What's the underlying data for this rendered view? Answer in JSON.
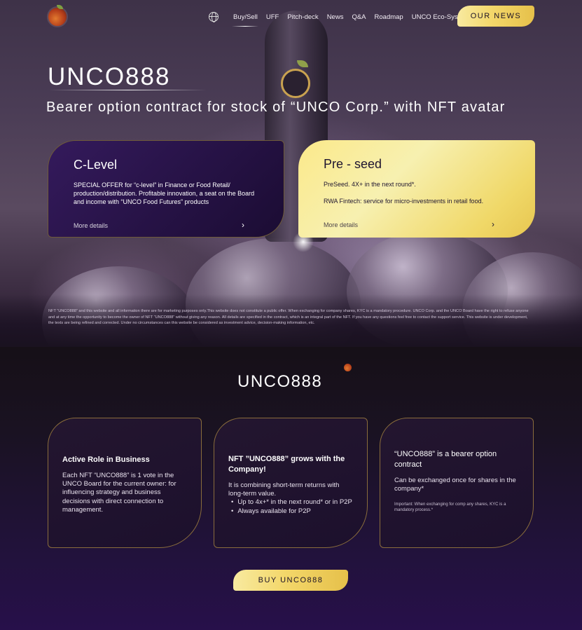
{
  "header": {
    "nav": [
      "Buy/Sell",
      "UFF",
      "Pitch-deck",
      "News",
      "Q&A",
      "Roadmap",
      "UNCO Eco-System"
    ],
    "news_button": "OUR NEWS"
  },
  "hero": {
    "title": "UNCO888",
    "subtitle": "Bearer option contract for stock of “UNCO Corp.” with NFT avatar"
  },
  "cards": [
    {
      "title": "C-Level",
      "paragraphs": [
        "SPECIAL OFFER for “c-level” in Finance or Food Retail/ production/distribution. Profitable innovation, a seat on the Board and income with “UNCO Food Futures” products"
      ],
      "more": "More details",
      "chevron": "›"
    },
    {
      "title": "Pre - seed",
      "paragraphs": [
        "PreSeed. 4X+ in the next round*.",
        "RWA Fintech: service for micro-investments in retail food."
      ],
      "more": "More details",
      "chevron": "›"
    }
  ],
  "disclaimer": "NFT “UNCO888” and this website and all information there are for marketing purposes only.This website does not constitute a public offer. When exchanging for company shares, KYC is a mandatory procedure. UNCO Corp. and the UNCO Board have the right to refuse anyone and at any time the opportunity to become the owner of NFT “UNCO888” without giving any reason. All details are specified in the contract, which is an integral part of the NFT. If you have any questions feel free to contact the support service. This website is under development, the texts are being refined and corrected. Under no circumstances can this website be considered as investment advice, decision-making information, etc.",
  "lower": {
    "logo": "UNCO888",
    "features": [
      {
        "title": "Active Role in Business",
        "text": "Each NFT “UNCO888” is 1 vote in the UNCO Board for the current owner: for influencing strategy and business decisions with direct connection to management."
      },
      {
        "title": "NFT ”UNCO888” grows with the  Company!",
        "text": "It is combining short-term returns with long-term value.",
        "bullets": [
          "Up to 4x+* in the next round* or in P2P",
          "Always available for P2P"
        ]
      },
      {
        "title": "“UNCO888” is a bearer option contract",
        "text": "Can be exchanged once for shares in the company*",
        "note": "Important: When exchanging for comp any shares, KYC is a mandatory process.*"
      }
    ],
    "buy_button": "BUY UNCO888"
  },
  "colors": {
    "gold": "#f3d76a",
    "card_dark": "#2a1448",
    "accent_border": "#8a6d3c"
  }
}
